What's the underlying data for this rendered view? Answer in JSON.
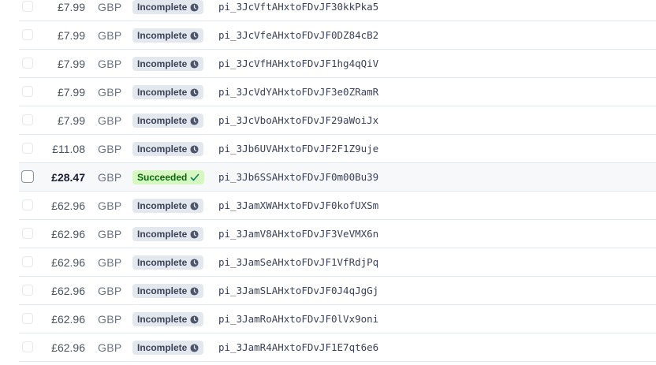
{
  "payments": [
    {
      "amount": "£7.99",
      "currency": "GBP",
      "status": "Incomplete",
      "status_type": "incomplete",
      "id": "pi_3JcVftAHxtoFDvJF30kkPka5"
    },
    {
      "amount": "£7.99",
      "currency": "GBP",
      "status": "Incomplete",
      "status_type": "incomplete",
      "id": "pi_3JcVfeAHxtoFDvJF0DZ84cB2"
    },
    {
      "amount": "£7.99",
      "currency": "GBP",
      "status": "Incomplete",
      "status_type": "incomplete",
      "id": "pi_3JcVfHAHxtoFDvJF1hg4qQiV"
    },
    {
      "amount": "£7.99",
      "currency": "GBP",
      "status": "Incomplete",
      "status_type": "incomplete",
      "id": "pi_3JcVdYAHxtoFDvJF3e0ZRamR"
    },
    {
      "amount": "£7.99",
      "currency": "GBP",
      "status": "Incomplete",
      "status_type": "incomplete",
      "id": "pi_3JcVboAHxtoFDvJF29aWoiJx"
    },
    {
      "amount": "£11.08",
      "currency": "GBP",
      "status": "Incomplete",
      "status_type": "incomplete",
      "id": "pi_3Jb6UVAHxtoFDvJF2F1Z9uje"
    },
    {
      "amount": "£28.47",
      "currency": "GBP",
      "status": "Succeeded",
      "status_type": "succeeded",
      "id": "pi_3Jb6SSAHxtoFDvJF0m00Bu39",
      "highlighted": true
    },
    {
      "amount": "£62.96",
      "currency": "GBP",
      "status": "Incomplete",
      "status_type": "incomplete",
      "id": "pi_3JamXWAHxtoFDvJF0kofUXSm"
    },
    {
      "amount": "£62.96",
      "currency": "GBP",
      "status": "Incomplete",
      "status_type": "incomplete",
      "id": "pi_3JamV8AHxtoFDvJF3VeVMX6n"
    },
    {
      "amount": "£62.96",
      "currency": "GBP",
      "status": "Incomplete",
      "status_type": "incomplete",
      "id": "pi_3JamSeAHxtoFDvJF1VfRdjPq"
    },
    {
      "amount": "£62.96",
      "currency": "GBP",
      "status": "Incomplete",
      "status_type": "incomplete",
      "id": "pi_3JamSLAHxtoFDvJF0J4qJgGj"
    },
    {
      "amount": "£62.96",
      "currency": "GBP",
      "status": "Incomplete",
      "status_type": "incomplete",
      "id": "pi_3JamRoAHxtoFDvJF0lVx9oni"
    },
    {
      "amount": "£62.96",
      "currency": "GBP",
      "status": "Incomplete",
      "status_type": "incomplete",
      "id": "pi_3JamR4AHxtoFDvJF1E7qt6e6"
    }
  ],
  "icons": {
    "incomplete": "clock-icon",
    "succeeded": "checkmark-icon"
  },
  "colors": {
    "incomplete_bg": "#e3e8ee",
    "incomplete_text": "#3c4257",
    "succeeded_bg": "#d7f7c2",
    "succeeded_text": "#05690d"
  }
}
